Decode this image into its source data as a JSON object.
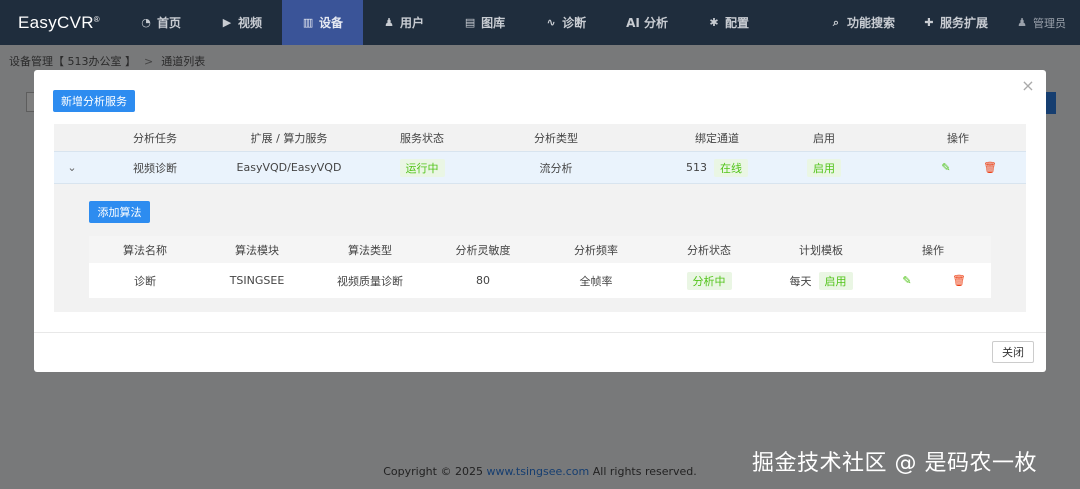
{
  "app": {
    "logo": "EasyCVR",
    "logo_mark": "®"
  },
  "nav": {
    "items": [
      {
        "label": "首页",
        "icon": "dashboard-icon"
      },
      {
        "label": "视频",
        "icon": "play-icon"
      },
      {
        "label": "设备",
        "icon": "device-icon",
        "active": true
      },
      {
        "label": "用户",
        "icon": "user-icon"
      },
      {
        "label": "图库",
        "icon": "gallery-icon"
      },
      {
        "label": "诊断",
        "icon": "pulse-icon"
      },
      {
        "label": "AI 分析",
        "icon": ""
      },
      {
        "label": "配置",
        "icon": "gear-icon"
      }
    ],
    "right": [
      {
        "label": "功能搜索",
        "icon": "search-icon"
      },
      {
        "label": "服务扩展",
        "icon": "puzzle-icon"
      },
      {
        "label": "管理员",
        "icon": "user-icon"
      }
    ]
  },
  "breadcrumb": {
    "first": "设备管理【 513办公室 】",
    "sep": ">",
    "second": "通道列表"
  },
  "modal": {
    "add_service_label": "新增分析服务",
    "close_label": "关闭",
    "table": {
      "headers": [
        "分析任务",
        "扩展 / 算力服务",
        "服务状态",
        "分析类型",
        "绑定通道",
        "启用",
        "操作"
      ],
      "row": {
        "task": "视频诊断",
        "service": "EasyVQD/EasyVQD",
        "status": "运行中",
        "type": "流分析",
        "channel_id": "513",
        "channel_status": "在线",
        "enabled": "启用"
      }
    },
    "sub": {
      "add_algo_label": "添加算法",
      "headers": [
        "算法名称",
        "算法模块",
        "算法类型",
        "分析灵敏度",
        "分析频率",
        "分析状态",
        "计划模板",
        "操作"
      ],
      "row": {
        "name": "诊断",
        "module": "TSINGSEE",
        "type": "视频质量诊断",
        "sensitivity": "80",
        "frequency": "全帧率",
        "status": "分析中",
        "plan": "每天",
        "plan_status": "启用"
      }
    }
  },
  "footer": {
    "prefix": "Copyright © 2025 ",
    "link": "www.tsingsee.com",
    "suffix": " All rights reserved."
  },
  "watermark": "掘金技术社区 @ 是码农一枚",
  "colors": {
    "primary": "#2d8cf0",
    "nav_bg": "#1f2d3d",
    "nav_active": "#3a5498",
    "success": "#52c41a",
    "danger": "#ed4014"
  }
}
